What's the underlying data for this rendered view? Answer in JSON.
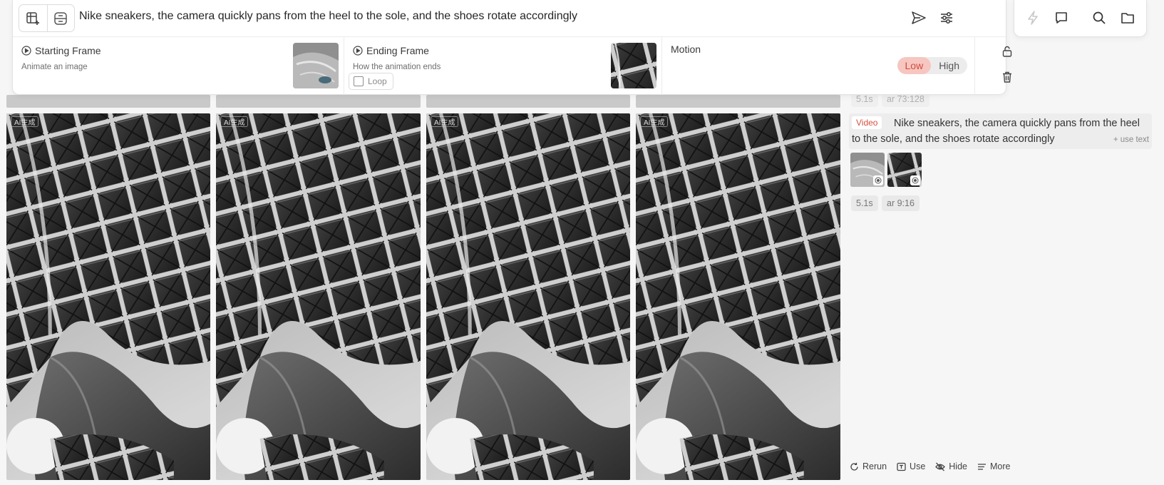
{
  "prompt": {
    "text": "Nike sneakers, the camera quickly pans from the heel to the sole, and the shoes rotate accordingly"
  },
  "frames": {
    "starting": {
      "title": "Starting Frame",
      "subtitle": "Animate an image"
    },
    "ending": {
      "title": "Ending Frame",
      "subtitle": "How the animation ends",
      "loop_label": "Loop",
      "loop_checked": false
    },
    "motion": {
      "title": "Motion",
      "options": [
        "Low",
        "High"
      ],
      "selected": "Low"
    }
  },
  "images": {
    "badge": "AI生成",
    "count": 4
  },
  "history": {
    "previous": {
      "duration": "5.1s",
      "aspect": "ar 73:128"
    },
    "current": {
      "tag": "Video",
      "prompt": "Nike sneakers, the camera quickly pans from the heel to the sole, and the shoes rotate accordingly",
      "use_text": "+ use text",
      "duration": "5.1s",
      "aspect": "ar 9:16"
    },
    "actions": {
      "rerun": "Rerun",
      "use": "Use",
      "hide": "Hide",
      "more": "More"
    }
  },
  "colors": {
    "accent": "#d14a3c",
    "accent_bg": "#f7c6c1",
    "panel_bg": "#ffffff",
    "page_bg": "#f6f6f6"
  },
  "icons": [
    "new-canvas-icon",
    "layout-icon",
    "send-icon",
    "sliders-icon",
    "lightning-icon",
    "chat-icon",
    "search-icon",
    "folder-icon",
    "lock-icon",
    "trash-icon",
    "play-circle-icon",
    "eye-icon",
    "rerun-icon",
    "use-icon",
    "hide-icon",
    "more-icon"
  ]
}
